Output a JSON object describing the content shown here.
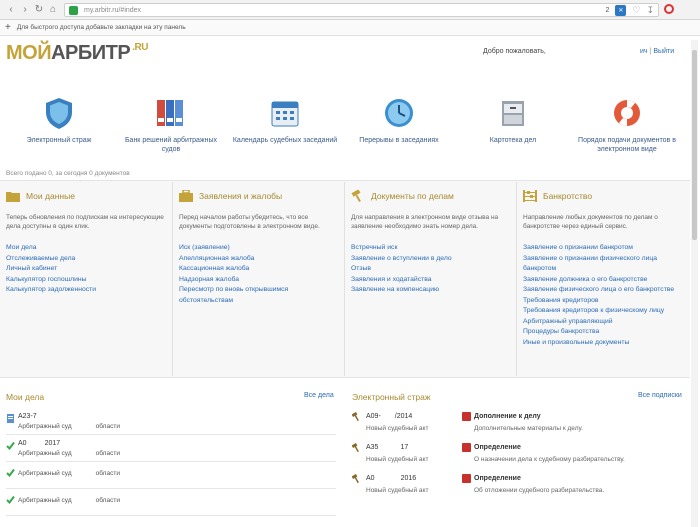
{
  "browser": {
    "url": "my.arbitr.ru/#index",
    "tab_count": "2",
    "bookmark_hint": "Для быстрого доступа добавьте закладки на эту панель"
  },
  "header": {
    "logo_moi": "МОЙ",
    "logo_arbitr": "АРБИТР",
    "logo_ru": ".RU",
    "welcome": "Добро пожаловать,",
    "user": "ич",
    "logout": "Выйти"
  },
  "services": [
    {
      "label": "Электронный страж",
      "icon": "shield-icon"
    },
    {
      "label": "Банк решений арбитражных судов",
      "icon": "binders-icon"
    },
    {
      "label": "Календарь судебных заседаний",
      "icon": "calendar-icon"
    },
    {
      "label": "Перерывы в заседаниях",
      "icon": "clock-icon"
    },
    {
      "label": "Картотека дел",
      "icon": "cabinet-icon"
    },
    {
      "label": "Порядок подачи документов в электронном виде",
      "icon": "lifebuoy-icon"
    }
  ],
  "counter": "Всего подано 0, за сегодня 0 документов",
  "columns": [
    {
      "title": "Мои данные",
      "desc": "Теперь обновления по подпискам на интересующие дела доступны в один клик.",
      "links": [
        "Мои дела",
        "Отслеживаемые дела",
        "Личный кабинет",
        "Калькулятор госпошлины",
        "Калькулятор задолженности"
      ]
    },
    {
      "title": "Заявления и жалобы",
      "desc": "Перед началом работы убедитесь, что все документы подготовлены в электронном виде.",
      "links": [
        "Иск (заявление)",
        "Апелляционная жалоба",
        "Кассационная жалоба",
        "Надзорная жалоба",
        "Пересмотр по вновь открывшимся обстоятельствам"
      ]
    },
    {
      "title": "Документы по делам",
      "desc": "Для направления в электронном виде отзыва на заявление необходимо знать номер дела.",
      "links": [
        "Встречный иск",
        "Заявление о вступлении в дело",
        "Отзыв",
        "Заявления и ходатайства",
        "Заявление на компенсацию"
      ]
    },
    {
      "title": "Банкротство",
      "desc": "Направление любых документов по делам о банкротстве через единый сервис.",
      "links": [
        "Заявление о признании банкротом",
        "Заявление о признании физического лица банкротом",
        "Заявление должника о его банкротстве",
        "Заявление физического лица о его банкротстве",
        "Требования кредиторов",
        "Требования кредиторов к физическому лицу",
        "Арбитражный управляющий",
        "Процедуры банкротства",
        "Иные и произвольные документы"
      ]
    }
  ],
  "my_cases": {
    "title": "Мои дела",
    "all_link": "Все дела",
    "items": [
      {
        "num": "А23-7",
        "court": "Арбитражный суд",
        "region": "области",
        "status": "doc"
      },
      {
        "num": "А0",
        "year": "2017",
        "court": "Арбитражный суд",
        "region": "области",
        "status": "ok"
      },
      {
        "num": "",
        "court": "Арбитражный суд",
        "region": "области",
        "status": "ok"
      },
      {
        "num": "",
        "court": "Арбитражный суд",
        "region": "области",
        "status": "ok"
      }
    ]
  },
  "guard": {
    "title": "Электронный страж",
    "all_link": "Все подписки",
    "items": [
      {
        "num": "А09-",
        "year": "/2014",
        "sub": "Новый судебный акт",
        "type": "Дополнение к делу",
        "desc": "Дополнительные материалы к делу."
      },
      {
        "num": "А35",
        "year": "17",
        "sub": "Новый судебный акт",
        "type": "Определение",
        "desc": "О назначении дела к судебному разбирательству."
      },
      {
        "num": "А0",
        "year": "2016",
        "sub": "Новый судебный акт",
        "type": "Определение",
        "desc": "Об отложении судебного разбирательства."
      }
    ]
  }
}
